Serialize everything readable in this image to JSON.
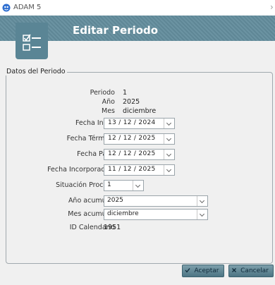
{
  "window": {
    "title": "ADAM 5",
    "close_glyph": "›"
  },
  "header": {
    "title": "Editar Periodo",
    "icon": "checklist-icon"
  },
  "group": {
    "legend": "Datos del Periodo",
    "fields": {
      "periodo": {
        "label": "Periodo",
        "value": "1"
      },
      "anio": {
        "label": "Año",
        "value": "2025"
      },
      "mes": {
        "label": "Mes",
        "value": "diciembre"
      },
      "fecha_inicio": {
        "label": "Fecha Inicio",
        "value": "13 / 12 / 2024"
      },
      "fecha_termino": {
        "label": "Fecha Término",
        "value": "12 / 12 / 2025"
      },
      "fecha_pago": {
        "label": "Fecha Pago",
        "value": "12 / 12 / 2025"
      },
      "fecha_incorporacion": {
        "label": "Fecha Incorporación",
        "value": "11 / 12 / 2025"
      },
      "situacion_proceso": {
        "label": "Situación Proceso",
        "value": "1"
      },
      "anio_acumular": {
        "label": "Año acumular",
        "value": "2025"
      },
      "mes_acumular": {
        "label": "Mes acumular",
        "value": "diciembre"
      },
      "id_calendario": {
        "label": "ID Calendario",
        "value": "1951"
      }
    }
  },
  "buttons": {
    "accept": "Aceptar",
    "cancel": "Cancelar"
  },
  "colors": {
    "header_bg": "#5f8796",
    "button_bg": "#4c7483"
  }
}
